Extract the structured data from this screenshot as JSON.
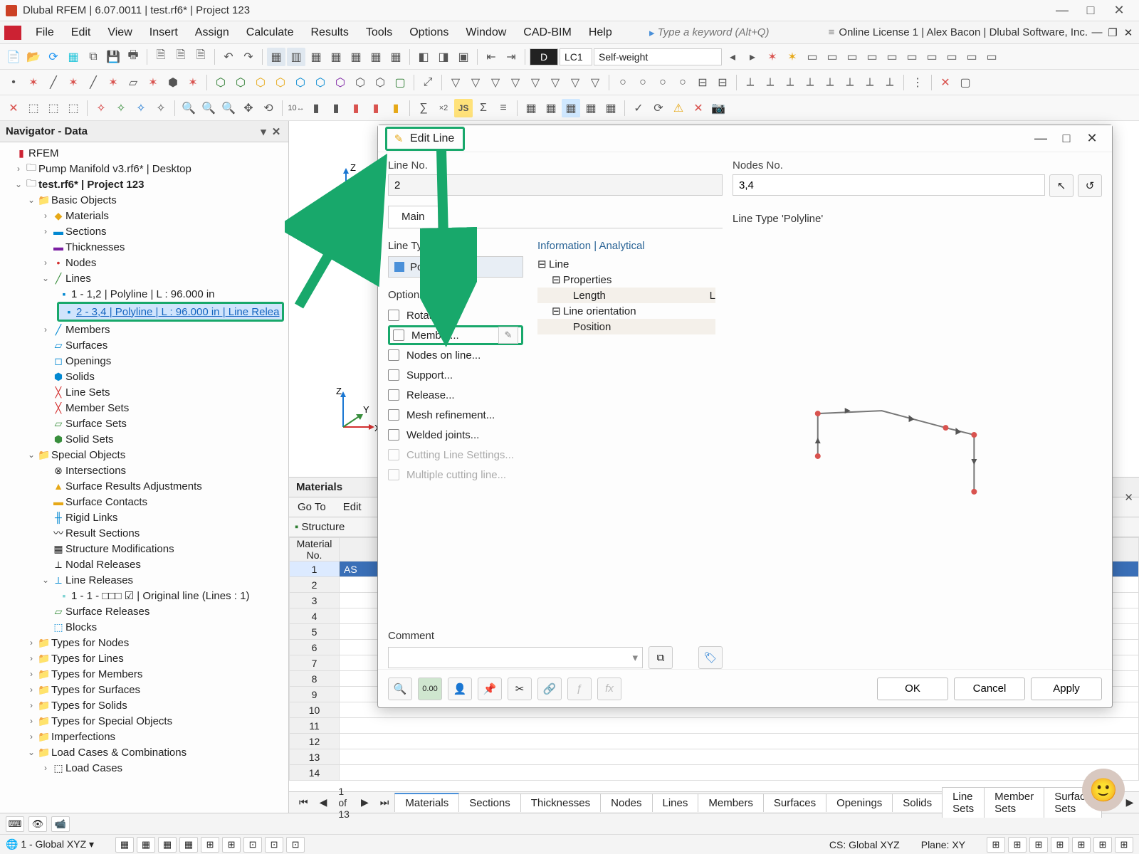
{
  "window": {
    "title": "Dlubal RFEM | 6.07.0011 | test.rf6* | Project 123",
    "min": "—",
    "max": "□",
    "close": "✕"
  },
  "menu": {
    "items": [
      "File",
      "Edit",
      "View",
      "Insert",
      "Assign",
      "Calculate",
      "Results",
      "Tools",
      "Options",
      "Window",
      "CAD-BIM",
      "Help"
    ],
    "search_placeholder": "Type a keyword (Alt+Q)",
    "license": "Online License 1 | Alex Bacon | Dlubal Software, Inc."
  },
  "toolbar2": {
    "lc_d": "D",
    "lc_code": "LC1",
    "lc_name": "Self-weight"
  },
  "nav": {
    "title": "Navigator - Data",
    "root": "RFEM",
    "proj1": "Pump Manifold v3.rf6* | Desktop",
    "proj2": "test.rf6* | Project 123",
    "basic": "Basic Objects",
    "materials": "Materials",
    "sections": "Sections",
    "thicknesses": "Thicknesses",
    "nodes": "Nodes",
    "lines": "Lines",
    "line1": "1 - 1,2 | Polyline | L : 96.000 in",
    "line2": "2 - 3,4 | Polyline | L : 96.000 in | Line Relea",
    "members": "Members",
    "surfaces": "Surfaces",
    "openings": "Openings",
    "solids": "Solids",
    "linesets": "Line Sets",
    "membersets": "Member Sets",
    "surfacesets": "Surface Sets",
    "solidsets": "Solid Sets",
    "special": "Special Objects",
    "intersections": "Intersections",
    "sra": "Surface Results Adjustments",
    "sc": "Surface Contacts",
    "rl": "Rigid Links",
    "rs": "Result Sections",
    "sm": "Structure Modifications",
    "nr": "Nodal Releases",
    "lr": "Line Releases",
    "lr1": "1 - 1 - □□□ ☑ | Original line (Lines : 1)",
    "sr": "Surface Releases",
    "blocks": "Blocks",
    "tfn": "Types for Nodes",
    "tfl": "Types for Lines",
    "tfm": "Types for Members",
    "tfs": "Types for Surfaces",
    "tfso": "Types for Solids",
    "tfsp": "Types for Special Objects",
    "imp": "Imperfections",
    "lcc": "Load Cases & Combinations",
    "lc": "Load Cases"
  },
  "materials_panel": {
    "title": "Materials",
    "tabs": [
      "Go To",
      "Edit"
    ],
    "structure": "Structure",
    "col": "Material\nNo.",
    "row1_val": "AS",
    "nav": "1 of 13",
    "btabs": [
      "Materials",
      "Sections",
      "Thicknesses",
      "Nodes",
      "Lines",
      "Members",
      "Surfaces",
      "Openings",
      "Solids",
      "Line Sets",
      "Member Sets",
      "Surface Sets"
    ]
  },
  "dialog": {
    "title": "Edit Line",
    "line_no_label": "Line No.",
    "line_no": "2",
    "nodes_no_label": "Nodes No.",
    "nodes_no": "3,4",
    "main_tab": "Main",
    "line_type_label": "Line Type",
    "line_type": "Polyline",
    "options_label": "Options",
    "opt_rotation": "Rotation...",
    "opt_member": "Member...",
    "opt_nodes": "Nodes on line...",
    "opt_support": "Support...",
    "opt_release": "Release...",
    "opt_mesh": "Mesh refinement...",
    "opt_welded": "Welded joints...",
    "opt_cutting": "Cutting Line Settings...",
    "opt_multi": "Multiple cutting line...",
    "info_title": "Information | Analytical",
    "info_line": "Line",
    "info_props": "Properties",
    "info_length": "Length",
    "info_length_sym": "L",
    "info_orient": "Line orientation",
    "info_pos": "Position",
    "preview_title": "Line Type 'Polyline'",
    "comment_label": "Comment",
    "ok": "OK",
    "cancel": "Cancel",
    "apply": "Apply"
  },
  "status": {
    "combo": "1 - Global XYZ",
    "cs": "CS: Global XYZ",
    "plane": "Plane: XY"
  }
}
